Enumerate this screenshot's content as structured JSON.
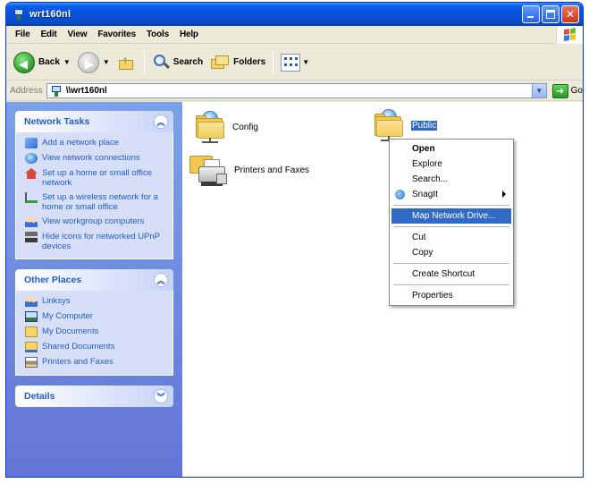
{
  "window": {
    "title": "wrt160nl"
  },
  "menubar": {
    "items": [
      "File",
      "Edit",
      "View",
      "Favorites",
      "Tools",
      "Help"
    ]
  },
  "toolbar": {
    "back_label": "Back",
    "search_label": "Search",
    "folders_label": "Folders"
  },
  "address": {
    "label": "Address",
    "value": "\\\\wrt160nl",
    "go_label": "Go"
  },
  "left_pane": {
    "network_tasks": {
      "header": "Network Tasks",
      "items": [
        {
          "label": "Add a network place",
          "icon": "network-place-icon"
        },
        {
          "label": "View network connections",
          "icon": "network-connections-icon"
        },
        {
          "label": "Set up a home or small office network",
          "icon": "home-network-icon"
        },
        {
          "label": "Set up a wireless network for a home or small office",
          "icon": "wireless-network-icon"
        },
        {
          "label": "View workgroup computers",
          "icon": "workgroup-icon"
        },
        {
          "label": "Hide icons for networked UPnP devices",
          "icon": "upnp-device-icon"
        }
      ]
    },
    "other_places": {
      "header": "Other Places",
      "items": [
        {
          "label": "Linksys",
          "icon": "workgroup-icon"
        },
        {
          "label": "My Computer",
          "icon": "my-computer-icon"
        },
        {
          "label": "My Documents",
          "icon": "my-documents-icon"
        },
        {
          "label": "Shared Documents",
          "icon": "shared-documents-icon"
        },
        {
          "label": "Printers and Faxes",
          "icon": "printer-icon"
        }
      ]
    },
    "details": {
      "header": "Details"
    }
  },
  "content": {
    "shares": [
      {
        "label": "Config"
      },
      {
        "label": "Printers and Faxes"
      },
      {
        "label": "Public"
      }
    ]
  },
  "context_menu": {
    "open": "Open",
    "explore": "Explore",
    "search": "Search...",
    "snagit": "SnagIt",
    "map_drive": "Map Network Drive...",
    "cut": "Cut",
    "copy": "Copy",
    "create_shortcut": "Create Shortcut",
    "properties": "Properties"
  },
  "colors": {
    "titlebar": "#0752d9",
    "task_pane": "#7ba2e7",
    "task_link": "#215dc6",
    "selection": "#316ac5"
  }
}
